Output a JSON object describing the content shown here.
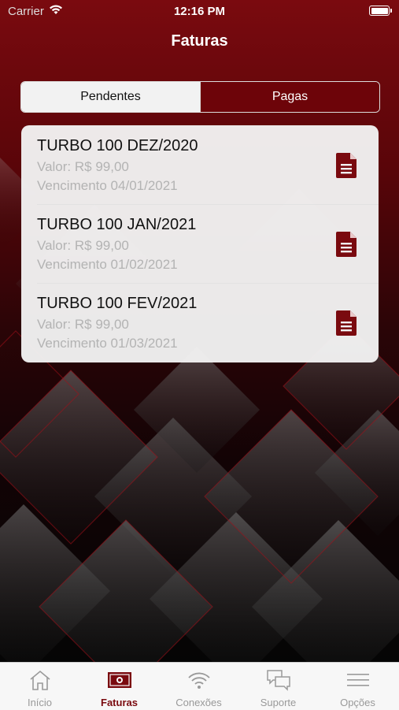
{
  "status_bar": {
    "carrier": "Carrier",
    "time": "12:16 PM"
  },
  "header": {
    "title": "Faturas"
  },
  "segments": {
    "pending": "Pendentes",
    "paid": "Pagas",
    "selected": "Pendentes"
  },
  "invoices": [
    {
      "name": "TURBO 100 DEZ/2020",
      "value": "Valor: R$ 99,00",
      "due": "Vencimento 04/01/2021"
    },
    {
      "name": "TURBO 100 JAN/2021",
      "value": "Valor: R$ 99,00",
      "due": "Vencimento 01/02/2021"
    },
    {
      "name": "TURBO 100 FEV/2021",
      "value": "Valor: R$ 99,00",
      "due": "Vencimento 01/03/2021"
    }
  ],
  "tabbar": {
    "items": [
      {
        "label": "Início",
        "icon": "home-icon"
      },
      {
        "label": "Faturas",
        "icon": "money-icon"
      },
      {
        "label": "Conexões",
        "icon": "wifi-icon"
      },
      {
        "label": "Suporte",
        "icon": "chat-icon"
      },
      {
        "label": "Opções",
        "icon": "menu-icon"
      }
    ],
    "selected": "Faturas"
  },
  "colors": {
    "accent": "#7a0a0f",
    "inactive_tab": "#999999",
    "card_bg": "#f2f2f2"
  }
}
